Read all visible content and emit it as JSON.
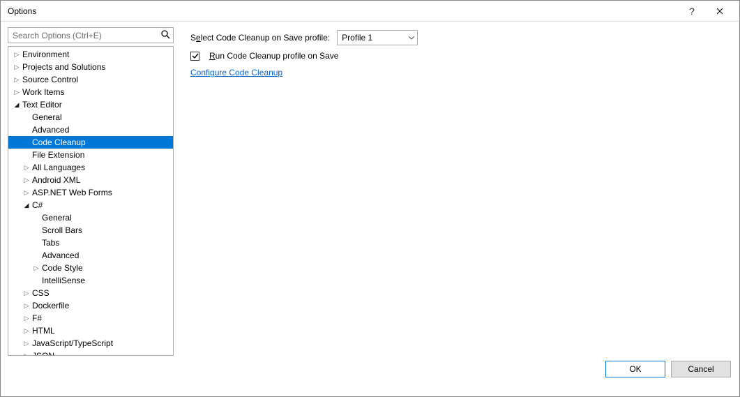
{
  "window": {
    "title": "Options"
  },
  "search": {
    "placeholder": "Search Options (Ctrl+E)"
  },
  "tree": [
    {
      "label": "Environment",
      "depth": 0,
      "arrow": "right",
      "selected": false
    },
    {
      "label": "Projects and Solutions",
      "depth": 0,
      "arrow": "right",
      "selected": false
    },
    {
      "label": "Source Control",
      "depth": 0,
      "arrow": "right",
      "selected": false
    },
    {
      "label": "Work Items",
      "depth": 0,
      "arrow": "right",
      "selected": false
    },
    {
      "label": "Text Editor",
      "depth": 0,
      "arrow": "down",
      "selected": false
    },
    {
      "label": "General",
      "depth": 1,
      "arrow": "",
      "selected": false
    },
    {
      "label": "Advanced",
      "depth": 1,
      "arrow": "",
      "selected": false
    },
    {
      "label": "Code Cleanup",
      "depth": 1,
      "arrow": "",
      "selected": true
    },
    {
      "label": "File Extension",
      "depth": 1,
      "arrow": "",
      "selected": false
    },
    {
      "label": "All Languages",
      "depth": 1,
      "arrow": "right",
      "selected": false
    },
    {
      "label": "Android XML",
      "depth": 1,
      "arrow": "right",
      "selected": false
    },
    {
      "label": "ASP.NET Web Forms",
      "depth": 1,
      "arrow": "right",
      "selected": false
    },
    {
      "label": "C#",
      "depth": 1,
      "arrow": "down",
      "selected": false
    },
    {
      "label": "General",
      "depth": 2,
      "arrow": "",
      "selected": false
    },
    {
      "label": "Scroll Bars",
      "depth": 2,
      "arrow": "",
      "selected": false
    },
    {
      "label": "Tabs",
      "depth": 2,
      "arrow": "",
      "selected": false
    },
    {
      "label": "Advanced",
      "depth": 2,
      "arrow": "",
      "selected": false
    },
    {
      "label": "Code Style",
      "depth": 2,
      "arrow": "right",
      "selected": false
    },
    {
      "label": "IntelliSense",
      "depth": 2,
      "arrow": "",
      "selected": false
    },
    {
      "label": "CSS",
      "depth": 1,
      "arrow": "right",
      "selected": false
    },
    {
      "label": "Dockerfile",
      "depth": 1,
      "arrow": "right",
      "selected": false
    },
    {
      "label": "F#",
      "depth": 1,
      "arrow": "right",
      "selected": false
    },
    {
      "label": "HTML",
      "depth": 1,
      "arrow": "right",
      "selected": false
    },
    {
      "label": "JavaScript/TypeScript",
      "depth": 1,
      "arrow": "right",
      "selected": false
    },
    {
      "label": "JSON",
      "depth": 1,
      "arrow": "right",
      "selected": false
    }
  ],
  "panel": {
    "profile_label_pre": "S",
    "profile_label_u": "e",
    "profile_label_post": "lect Code Cleanup on Save profile:",
    "profile_selected": "Profile 1",
    "checkbox_checked": true,
    "checkbox_label_u": "R",
    "checkbox_label_post": "un Code Cleanup profile on Save",
    "link": "Configure Code Cleanup"
  },
  "footer": {
    "ok": "OK",
    "cancel": "Cancel"
  }
}
